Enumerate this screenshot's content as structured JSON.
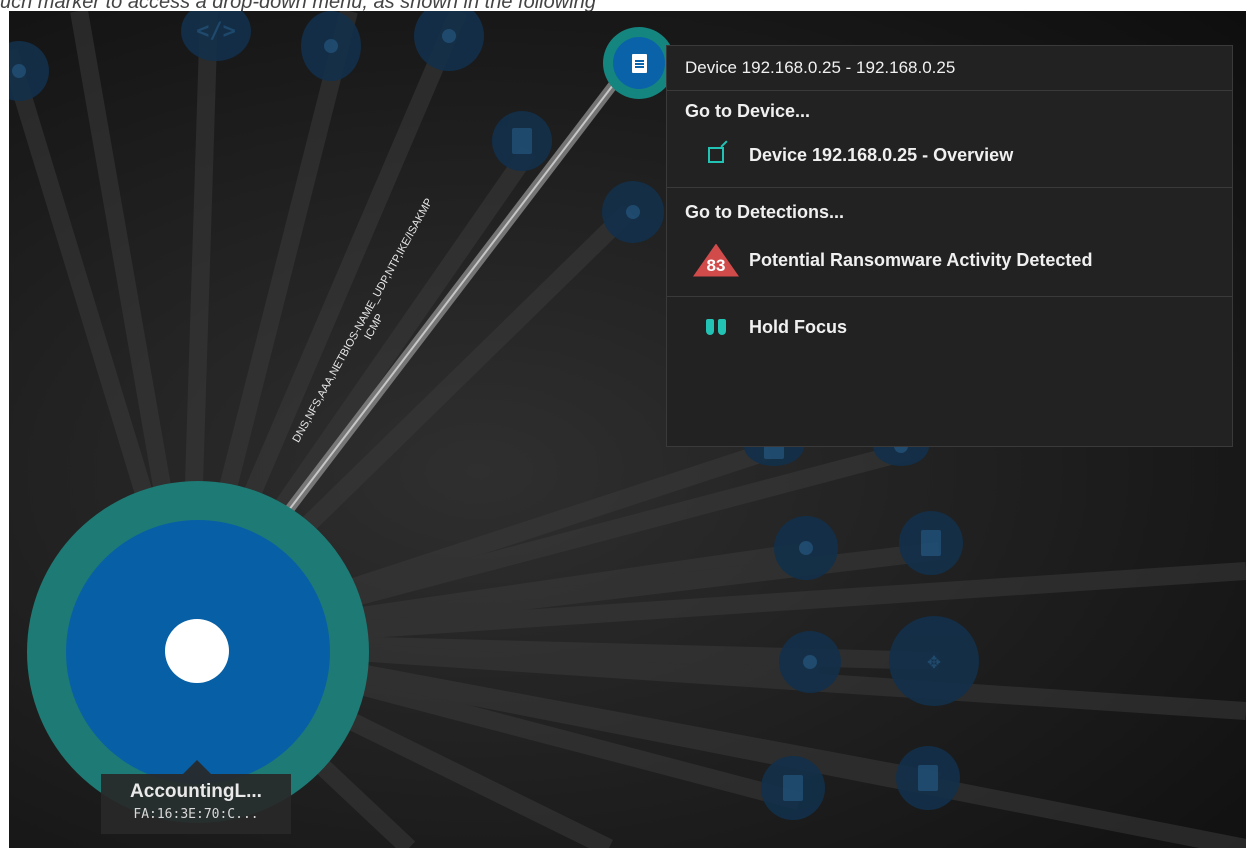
{
  "caption": "uch marker to access a drop-down menu, as shown in the following",
  "focus_device": {
    "icon": "document-icon"
  },
  "main_device": {
    "name": "AccountingL...",
    "mac": "FA:16:3E:70:C..."
  },
  "edge": {
    "protocols_line1": "DNS,NFS,AAA,NETBIOS-NAME_UDP,NTP,IKE/ISAKMP",
    "protocols_line2": "ICMP"
  },
  "context_menu": {
    "title": "Device 192.168.0.25 - 192.168.0.25",
    "section_device": "Go to Device...",
    "device_overview": "Device 192.168.0.25 - Overview",
    "section_detections": "Go to Detections...",
    "detection_score": "83",
    "detection_label": "Potential Ransomware Activity Detected",
    "hold_focus": "Hold Focus"
  },
  "colors": {
    "accent_teal": "#22c3b4",
    "node_blue": "#0760a6",
    "ring_teal": "#1e7a75",
    "detection_red": "#d14b4b"
  }
}
